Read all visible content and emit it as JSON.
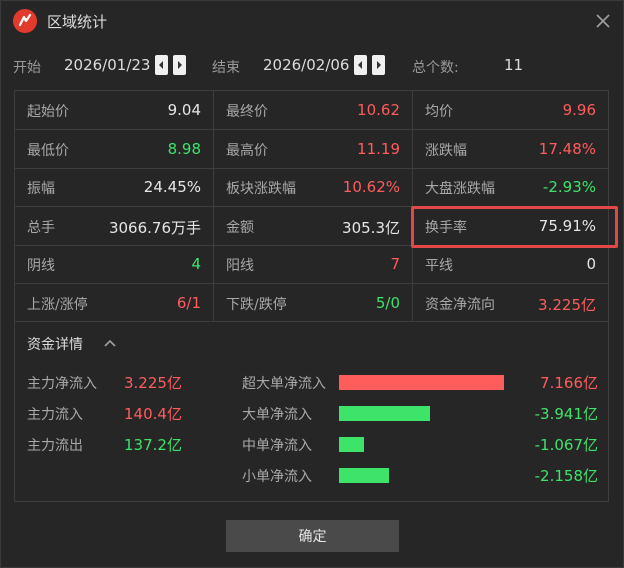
{
  "window": {
    "title": "区域统计"
  },
  "range": {
    "start_label": "开始",
    "start_date": "2026/01/23",
    "end_label": "结束",
    "end_date": "2026/02/06",
    "count_label": "总个数:",
    "count_value": "11"
  },
  "stats": [
    [
      {
        "k": "起始价",
        "v": "9.04",
        "c": "white"
      },
      {
        "k": "最终价",
        "v": "10.62",
        "c": "red"
      },
      {
        "k": "均价",
        "v": "9.96",
        "c": "red"
      }
    ],
    [
      {
        "k": "最低价",
        "v": "8.98",
        "c": "green"
      },
      {
        "k": "最高价",
        "v": "11.19",
        "c": "red"
      },
      {
        "k": "涨跌幅",
        "v": "17.48%",
        "c": "red"
      }
    ],
    [
      {
        "k": "振幅",
        "v": "24.45%",
        "c": "white"
      },
      {
        "k": "板块涨跌幅",
        "v": "10.62%",
        "c": "red"
      },
      {
        "k": "大盘涨跌幅",
        "v": "-2.93%",
        "c": "green"
      }
    ],
    [
      {
        "k": "总手",
        "v": "3066.76万手",
        "c": "white"
      },
      {
        "k": "金额",
        "v": "305.3亿",
        "c": "white"
      },
      {
        "k": "换手率",
        "v": "75.91%",
        "c": "white"
      }
    ],
    [
      {
        "k": "阴线",
        "v": "4",
        "c": "green"
      },
      {
        "k": "阳线",
        "v": "7",
        "c": "red"
      },
      {
        "k": "平线",
        "v": "0",
        "c": "white"
      }
    ],
    [
      {
        "k": "上涨/涨停",
        "v": "6/1",
        "c": "red"
      },
      {
        "k": "下跌/跌停",
        "v": "5/0",
        "c": "green"
      },
      {
        "k": "资金净流向",
        "v": "3.225亿",
        "c": "red"
      }
    ]
  ],
  "funds": {
    "title": "资金详情",
    "left": [
      {
        "k": "主力净流入",
        "v": "3.225亿",
        "c": "red"
      },
      {
        "k": "主力流入",
        "v": "140.4亿",
        "c": "red"
      },
      {
        "k": "主力流出",
        "v": "137.2亿",
        "c": "green"
      }
    ],
    "flows": [
      {
        "k": "超大单净流入",
        "v": "7.166亿",
        "c": "red",
        "amount": 7.166
      },
      {
        "k": "大单净流入",
        "v": "-3.941亿",
        "c": "green",
        "amount": -3.941
      },
      {
        "k": "中单净流入",
        "v": "-1.067亿",
        "c": "green",
        "amount": -1.067
      },
      {
        "k": "小单净流入",
        "v": "-2.158亿",
        "c": "green",
        "amount": -2.158
      }
    ]
  },
  "footer": {
    "confirm_label": "确定"
  },
  "colors": {
    "red": "#ff5c5c",
    "green": "#3ee36a",
    "highlight": "#e24848"
  }
}
